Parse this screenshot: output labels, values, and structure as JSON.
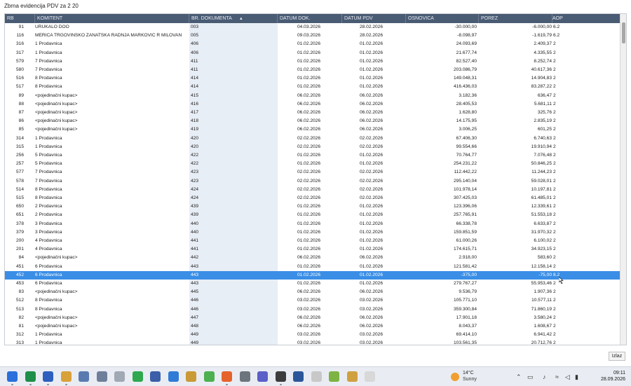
{
  "window": {
    "title": "Zbrna evidencija PDV za 2 20"
  },
  "columns": [
    "RB",
    "KOMITENT",
    "BR. DOKUMENTA",
    "DATUM DOK.",
    "DATUM PDV",
    "OSNOVICA",
    "POREZ",
    "AOP"
  ],
  "rows": [
    [
      "91",
      "URUKALO DOO",
      "003",
      "04.03.2026",
      "28.02.2026",
      "-30.000,00",
      "-6.000,00",
      "6.2"
    ],
    [
      "116",
      "MERICA TRGOVINSKO ZANATSKA  RADNJA MARKOVIC R MILOVAN",
      "005",
      "09.03.2026",
      "28.02.2026",
      "-8.098,97",
      "-1.619,79",
      "6.2"
    ],
    [
      "316",
      "1 Prodavnica",
      "406",
      "01.02.2026",
      "01.02.2026",
      "24.093,69",
      "2.409,37",
      "2"
    ],
    [
      "317",
      "1 Prodavnica",
      "406",
      "01.02.2026",
      "01.02.2026",
      "21.677,74",
      "4.335,55",
      "2"
    ],
    [
      "579",
      "7 Prodavnica",
      "411",
      "01.02.2026",
      "01.02.2026",
      "82.527,40",
      "8.252,74",
      "2"
    ],
    [
      "580",
      "7 Prodavnica",
      "411",
      "01.02.2026",
      "01.02.2026",
      "203.086,79",
      "40.617,36",
      "2"
    ],
    [
      "516",
      "8 Prodavnica",
      "414",
      "01.02.2026",
      "01.02.2026",
      "149.048,31",
      "14.904,83",
      "2"
    ],
    [
      "517",
      "8 Prodavnica",
      "414",
      "01.02.2026",
      "01.02.2026",
      "416.436,03",
      "83.287,22",
      "2"
    ],
    [
      "89",
      "<pojedinačni kupac>",
      "415",
      "06.02.2026",
      "06.02.2026",
      "3.182,36",
      "636,47",
      "2"
    ],
    [
      "88",
      "<pojedinačni kupac>",
      "416",
      "06.02.2026",
      "06.02.2026",
      "28.405,53",
      "5.681,11",
      "2"
    ],
    [
      "87",
      "<pojedinačni kupac>",
      "417",
      "06.02.2026",
      "06.02.2026",
      "1.628,80",
      "325,76",
      "2"
    ],
    [
      "86",
      "<pojedinačni kupac>",
      "418",
      "06.02.2026",
      "06.02.2026",
      "14.175,95",
      "2.835,19",
      "2"
    ],
    [
      "85",
      "<pojedinačni kupac>",
      "419",
      "06.02.2026",
      "06.02.2026",
      "3.006,25",
      "601,25",
      "2"
    ],
    [
      "314",
      "1 Prodavnica",
      "420",
      "02.02.2026",
      "02.02.2026",
      "67.406,30",
      "6.740,63",
      "2"
    ],
    [
      "315",
      "1 Prodavnica",
      "420",
      "02.02.2026",
      "02.02.2026",
      "99.554,66",
      "19.910,94",
      "2"
    ],
    [
      "256",
      "5 Prodavnica",
      "422",
      "01.02.2026",
      "01.02.2026",
      "70.764,77",
      "7.076,48",
      "2"
    ],
    [
      "257",
      "5 Prodavnica",
      "422",
      "01.02.2026",
      "01.02.2026",
      "254.231,22",
      "50.846,25",
      "2"
    ],
    [
      "577",
      "7 Prodavnica",
      "423",
      "02.02.2026",
      "02.02.2026",
      "112.442,22",
      "11.244,23",
      "2"
    ],
    [
      "578",
      "7 Prodavnica",
      "423",
      "02.02.2026",
      "02.02.2026",
      "295.140,04",
      "59.028,01",
      "2"
    ],
    [
      "514",
      "8 Prodavnica",
      "424",
      "02.02.2026",
      "02.02.2026",
      "101.978,14",
      "10.197,81",
      "2"
    ],
    [
      "515",
      "8 Prodavnica",
      "424",
      "02.02.2026",
      "02.02.2026",
      "307.425,03",
      "61.485,01",
      "2"
    ],
    [
      "650",
      "2 Prodavnica",
      "439",
      "01.02.2026",
      "01.02.2026",
      "123.396,06",
      "12.339,61",
      "2"
    ],
    [
      "651",
      "2 Prodavnica",
      "439",
      "01.02.2026",
      "01.02.2026",
      "257.765,91",
      "51.553,18",
      "2"
    ],
    [
      "378",
      "3 Prodavnica",
      "440",
      "01.02.2026",
      "01.02.2026",
      "66.338,78",
      "6.633,87",
      "2"
    ],
    [
      "379",
      "3 Prodavnica",
      "440",
      "01.02.2026",
      "01.02.2026",
      "159.851,59",
      "31.970,32",
      "2"
    ],
    [
      "200",
      "4 Prodavnica",
      "441",
      "01.02.2026",
      "01.02.2026",
      "61.000,26",
      "6.100,02",
      "2"
    ],
    [
      "201",
      "4 Prodavnica",
      "441",
      "01.02.2026",
      "01.02.2026",
      "174.615,71",
      "34.923,15",
      "2"
    ],
    [
      "84",
      "<pojedinačni kupac>",
      "442",
      "06.02.2026",
      "06.02.2026",
      "2.918,00",
      "583,60",
      "2"
    ],
    [
      "451",
      "6 Prodavnica",
      "443",
      "01.02.2026",
      "01.02.2026",
      "121.581,42",
      "12.158,14",
      "2"
    ],
    [
      "452",
      "6 Prodavnica",
      "443",
      "01.02.2026",
      "01.02.2026",
      "-375,00",
      "-75,00",
      "8.2"
    ],
    [
      "453",
      "6 Prodavnica",
      "443",
      "01.02.2026",
      "01.02.2026",
      "279.767,27",
      "55.953,46",
      "2"
    ],
    [
      "83",
      "<pojedinačni kupac>",
      "445",
      "06.02.2026",
      "06.02.2026",
      "9.536,79",
      "1.907,36",
      "2"
    ],
    [
      "512",
      "8 Prodavnica",
      "446",
      "03.02.2026",
      "03.02.2026",
      "105.771,10",
      "10.577,11",
      "2"
    ],
    [
      "513",
      "8 Prodavnica",
      "446",
      "03.02.2026",
      "03.02.2026",
      "359.300,84",
      "71.860,19",
      "2"
    ],
    [
      "82",
      "<pojedinačni kupac>",
      "447",
      "06.02.2026",
      "06.02.2026",
      "17.901,18",
      "3.580,24",
      "2"
    ],
    [
      "81",
      "<pojedinačni kupac>",
      "448",
      "06.02.2026",
      "06.02.2026",
      "8.043,37",
      "1.608,67",
      "2"
    ],
    [
      "312",
      "1 Prodavnica",
      "449",
      "03.02.2026",
      "03.02.2026",
      "69.414,10",
      "6.941,42",
      "2"
    ],
    [
      "313",
      "1 Prodavnica",
      "449",
      "03.02.2026",
      "03.02.2026",
      "103.561,35",
      "20.712,76",
      "2"
    ]
  ],
  "selected_row_index": 29,
  "buttons": {
    "close": "Izlaz"
  },
  "taskbar": {
    "weather_temp": "14°C",
    "weather_desc": "Sunny",
    "time": "09:11",
    "date": "28.09.2026",
    "app_icons": [
      "start-icon",
      "excel-icon",
      "save-icon",
      "folder-icon",
      "database-icon",
      "window-icon",
      "note-icon",
      "green-doc-icon",
      "person-icon",
      "chart-icon",
      "folder2-icon",
      "chat-icon",
      "firefox-icon",
      "tools-icon",
      "teams-icon",
      "chrome-icon",
      "word-icon",
      "pdf-icon",
      "download-icon",
      "file-manager-icon",
      "notepad-icon"
    ]
  },
  "colors": {
    "header_bg": "#4a5b74",
    "selected_row": "#3a8ee6",
    "taskbar_bg": "#e9edf3"
  }
}
